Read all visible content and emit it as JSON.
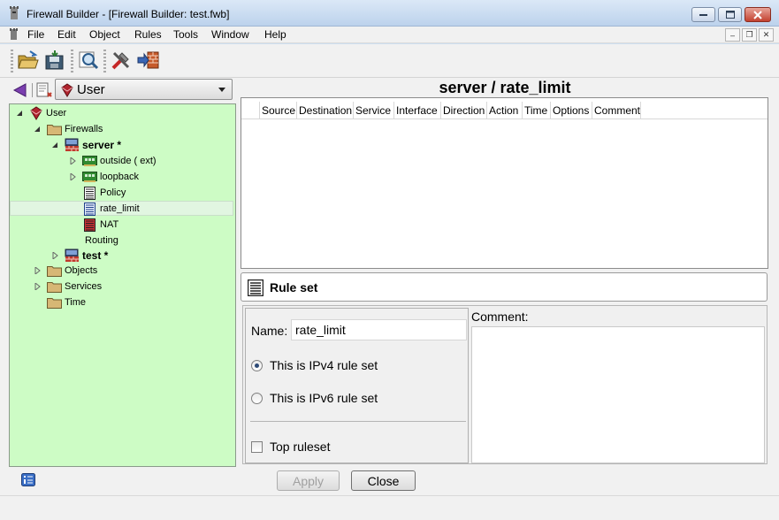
{
  "window": {
    "title": "Firewall Builder - [Firewall Builder: test.fwb]"
  },
  "menu": [
    "File",
    "Edit",
    "Object",
    "Rules",
    "Tools",
    "Window",
    "Help"
  ],
  "toolbar": {
    "icons": [
      "open-folder-icon",
      "save-icon",
      "find-icon",
      "compile-icon",
      "install-icon"
    ]
  },
  "library": {
    "selected": "User"
  },
  "tree": {
    "user": "User",
    "firewalls": "Firewalls",
    "server": "server *",
    "outside": "outside ( ext)",
    "loopback": "loopback",
    "policy": "Policy",
    "rate_limit": "rate_limit",
    "nat": "NAT",
    "routing": "Routing",
    "test": "test *",
    "objects": "Objects",
    "services": "Services",
    "time": "Time"
  },
  "object_title": "server / rate_limit",
  "rules_columns": [
    "Source",
    "Destination",
    "Service",
    "Interface",
    "Direction",
    "Action",
    "Time",
    "Options",
    "Comment"
  ],
  "ruleset": {
    "header": "Rule set",
    "name_label": "Name:",
    "name_value": "rate_limit",
    "ipv4_label": "This is IPv4 rule set",
    "ipv6_label": "This is IPv6 rule set",
    "ipv4_checked": true,
    "top_ruleset_label": "Top ruleset",
    "top_ruleset_checked": false,
    "comment_label": "Comment:",
    "comment_value": ""
  },
  "buttons": {
    "apply": "Apply",
    "close": "Close"
  },
  "colors": {
    "tree_bg": "#cdfcc5",
    "window_bg": "#f1f1f1"
  }
}
